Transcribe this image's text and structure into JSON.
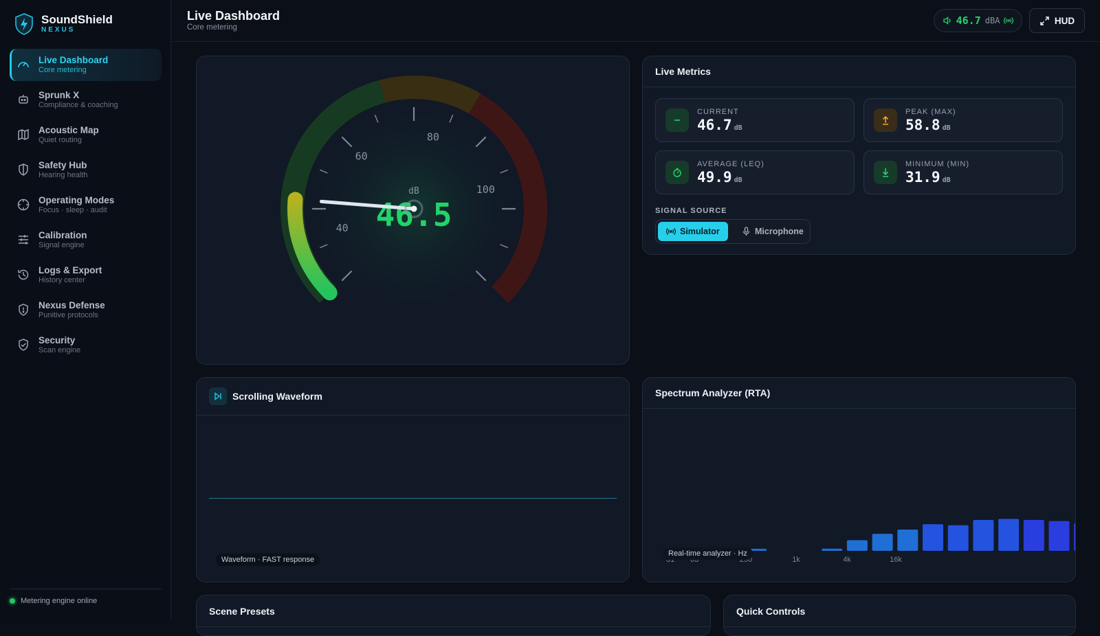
{
  "brand": {
    "name": "SoundShield",
    "sub": "NEXUS"
  },
  "nav": [
    {
      "title": "Live Dashboard",
      "sub": "Core metering"
    },
    {
      "title": "Sprunk X",
      "sub": "Compliance & coaching"
    },
    {
      "title": "Acoustic Map",
      "sub": "Quiet routing"
    },
    {
      "title": "Safety Hub",
      "sub": "Hearing health"
    },
    {
      "title": "Operating Modes",
      "sub": "Focus · sleep · audit"
    },
    {
      "title": "Calibration",
      "sub": "Signal engine"
    },
    {
      "title": "Logs & Export",
      "sub": "History center"
    },
    {
      "title": "Nexus Defense",
      "sub": "Punitive protocols"
    },
    {
      "title": "Security",
      "sub": "Scan engine"
    }
  ],
  "status": "Metering engine online",
  "header": {
    "title": "Live Dashboard",
    "subtitle": "Core metering",
    "level": "46.7",
    "level_unit": "dBA",
    "hud": "HUD"
  },
  "gauge": {
    "value": "46.5",
    "unit": "dB",
    "ticks": [
      "40",
      "60",
      "80",
      "100"
    ],
    "level": 46.5,
    "min": 30,
    "max": 120
  },
  "metrics": {
    "title": "Live Metrics",
    "items": [
      {
        "label": "CURRENT",
        "value": "46.7",
        "unit": "dB"
      },
      {
        "label": "PEAK (MAX)",
        "value": "58.8",
        "unit": "dB"
      },
      {
        "label": "AVERAGE (LEQ)",
        "value": "49.9",
        "unit": "dB"
      },
      {
        "label": "MINIMUM (MIN)",
        "value": "31.9",
        "unit": "dB"
      }
    ],
    "source_label": "SIGNAL SOURCE",
    "sources": [
      "Simulator",
      "Microphone"
    ]
  },
  "waveform": {
    "title": "Scrolling Waveform",
    "caption": "Waveform · FAST response"
  },
  "spectrum": {
    "title": "Spectrum Analyzer (RTA)",
    "caption": "Real-time analyzer · Hz",
    "labels": [
      "31",
      "63",
      "250",
      "1k",
      "4k",
      "16k"
    ],
    "bars": [
      0,
      1,
      0,
      1,
      0,
      0,
      2,
      10,
      16,
      20,
      25,
      24,
      29,
      30,
      29,
      28,
      26
    ]
  },
  "bottom": {
    "scene": "Scene Presets",
    "quick": "Quick Controls"
  },
  "colors": {
    "accent": "#27c6e8",
    "good": "#22c55e",
    "warn": "#f59e0b",
    "danger": "#dc2626"
  }
}
